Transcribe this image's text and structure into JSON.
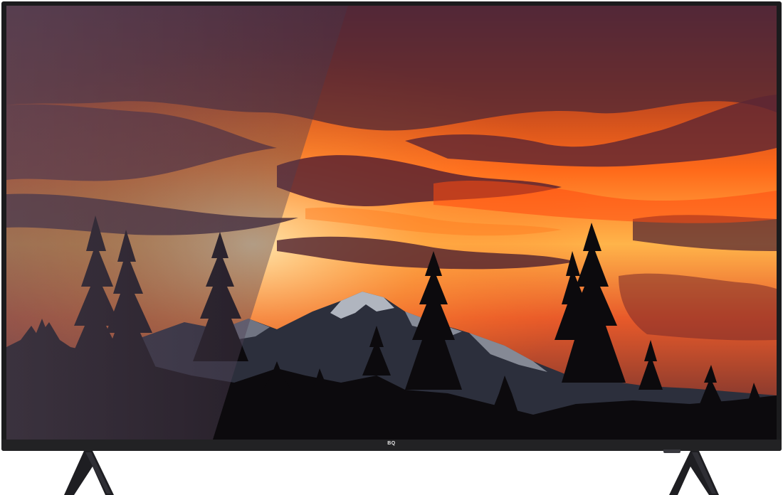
{
  "product": {
    "brand_logo": "BQ"
  },
  "screen_image": {
    "scene": "sunset-mountain-forest"
  },
  "colors": {
    "bezel": "#1b1b1d",
    "sky_bright": "#ff5a12",
    "sky_dark": "#3c2436",
    "silhouette": "#0c0a0d",
    "mountain": "#2c2f3c"
  }
}
